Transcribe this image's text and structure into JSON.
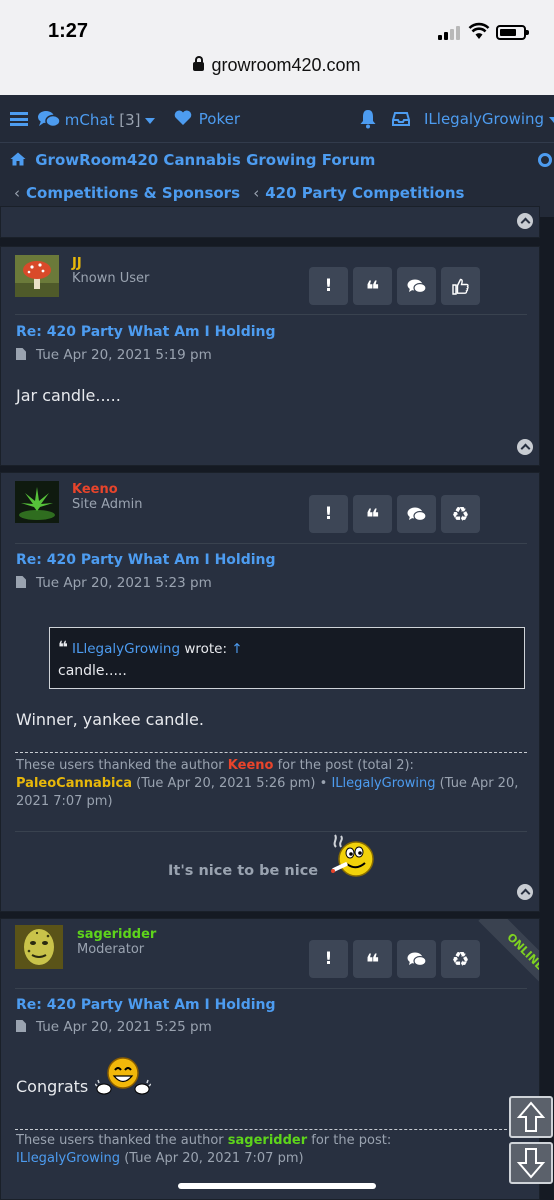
{
  "status_bar": {
    "time": "1:27",
    "url": "growroom420.com"
  },
  "nav": {
    "mchat_label": "mChat",
    "mchat_count": "[3]",
    "poker_label": "Poker",
    "username": "ILlegalyGrowing",
    "forum_title": "GrowRoom420 Cannabis Growing Forum",
    "breadcrumbs": [
      "Competitions & Sponsors",
      "420 Party Competitions"
    ]
  },
  "colors": {
    "link": "#4d9cf0",
    "admin": "#e8442b",
    "moderator": "#5ed41b",
    "known_user": "#e8b80a"
  },
  "posts": [
    {
      "author": "JJ",
      "rank": "Known User",
      "title": "Re: 420 Party What Am I Holding",
      "date": "Tue Apr 20, 2021 5:19 pm",
      "body": "Jar candle.....",
      "buttons": [
        "report",
        "quote",
        "pm",
        "like"
      ]
    },
    {
      "author": "Keeno",
      "rank": "Site Admin",
      "title": "Re: 420 Party What Am I Holding",
      "date": "Tue Apr 20, 2021 5:23 pm",
      "quote": {
        "author": "ILlegalyGrowing",
        "wrote": "wrote:",
        "arrow": "↑",
        "text": "candle....."
      },
      "body": "Winner, yankee candle.",
      "thanks": {
        "prefix": "These users thanked the author",
        "author": "Keeno",
        "suffix": "for the post (total 2):",
        "user1": "PaleoCannabica",
        "user1_time": "(Tue Apr 20, 2021 5:26 pm)",
        "bullet": "•",
        "user2": "ILlegalyGrowing",
        "user2_time": "(Tue Apr 20, 2021 7:07 pm)"
      },
      "signature": "It's nice to be nice",
      "buttons": [
        "report",
        "quote",
        "pm",
        "recycle"
      ]
    },
    {
      "author": "sageridder",
      "rank": "Moderator",
      "status_ribbon": "ONLINE",
      "title": "Re: 420 Party What Am I Holding",
      "date": "Tue Apr 20, 2021 5:25 pm",
      "body": "Congrats",
      "thanks": {
        "prefix": "These users thanked the author",
        "author": "sageridder",
        "suffix": "for the post:",
        "user1": "ILlegalyGrowing",
        "user1_time": "(Tue Apr 20, 2021 7:07 pm)"
      },
      "buttons": [
        "report",
        "quote",
        "pm",
        "recycle"
      ]
    }
  ]
}
